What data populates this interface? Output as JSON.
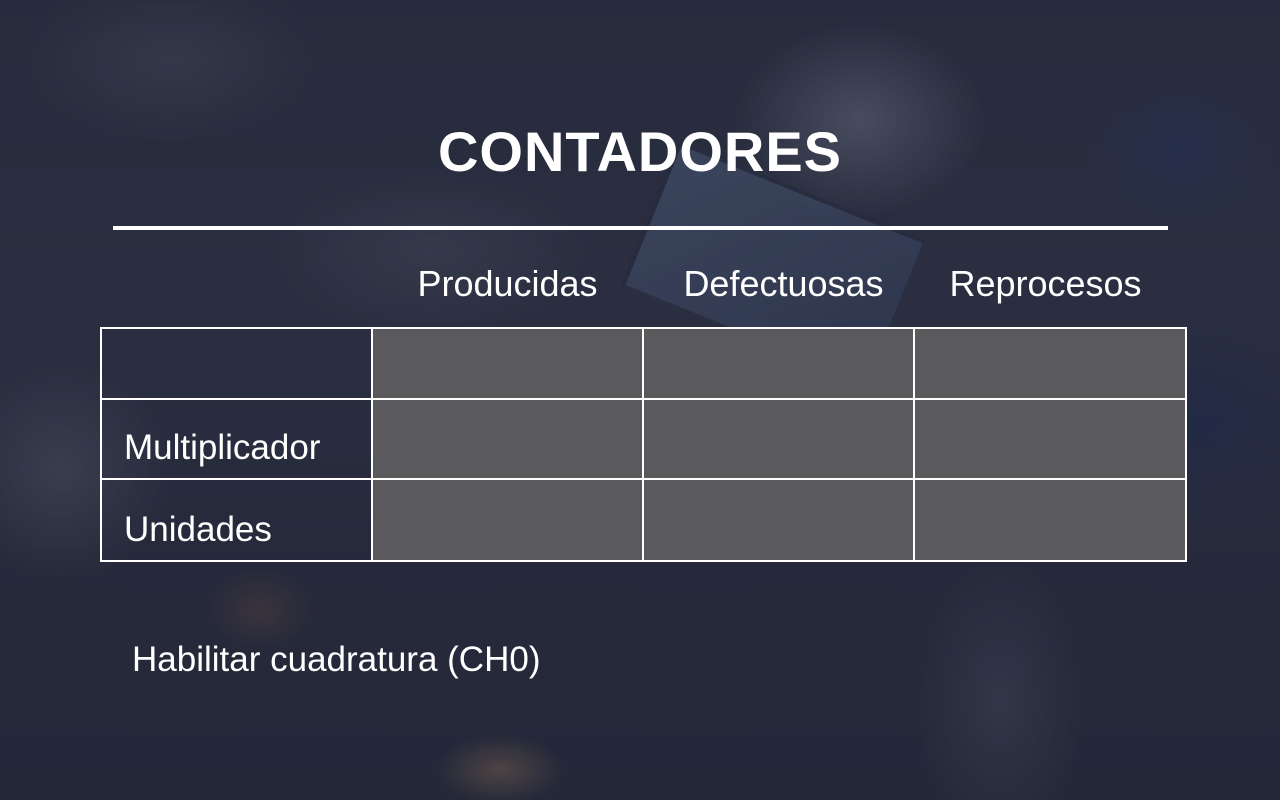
{
  "page": {
    "title": "CONTADORES"
  },
  "table": {
    "columns": [
      "Producidas",
      "Defectuosas",
      "Reprocesos"
    ],
    "rows": [
      {
        "label": "",
        "values": [
          "",
          "",
          ""
        ]
      },
      {
        "label": "Multiplicador",
        "values": [
          "",
          "",
          ""
        ]
      },
      {
        "label": "Unidades",
        "values": [
          "",
          "",
          ""
        ]
      }
    ]
  },
  "options": {
    "quadrature_label": "Habilitar cuadratura (CH0)"
  },
  "colors": {
    "input_cell": "#5a595c",
    "border": "#ffffff",
    "text": "#ffffff"
  }
}
